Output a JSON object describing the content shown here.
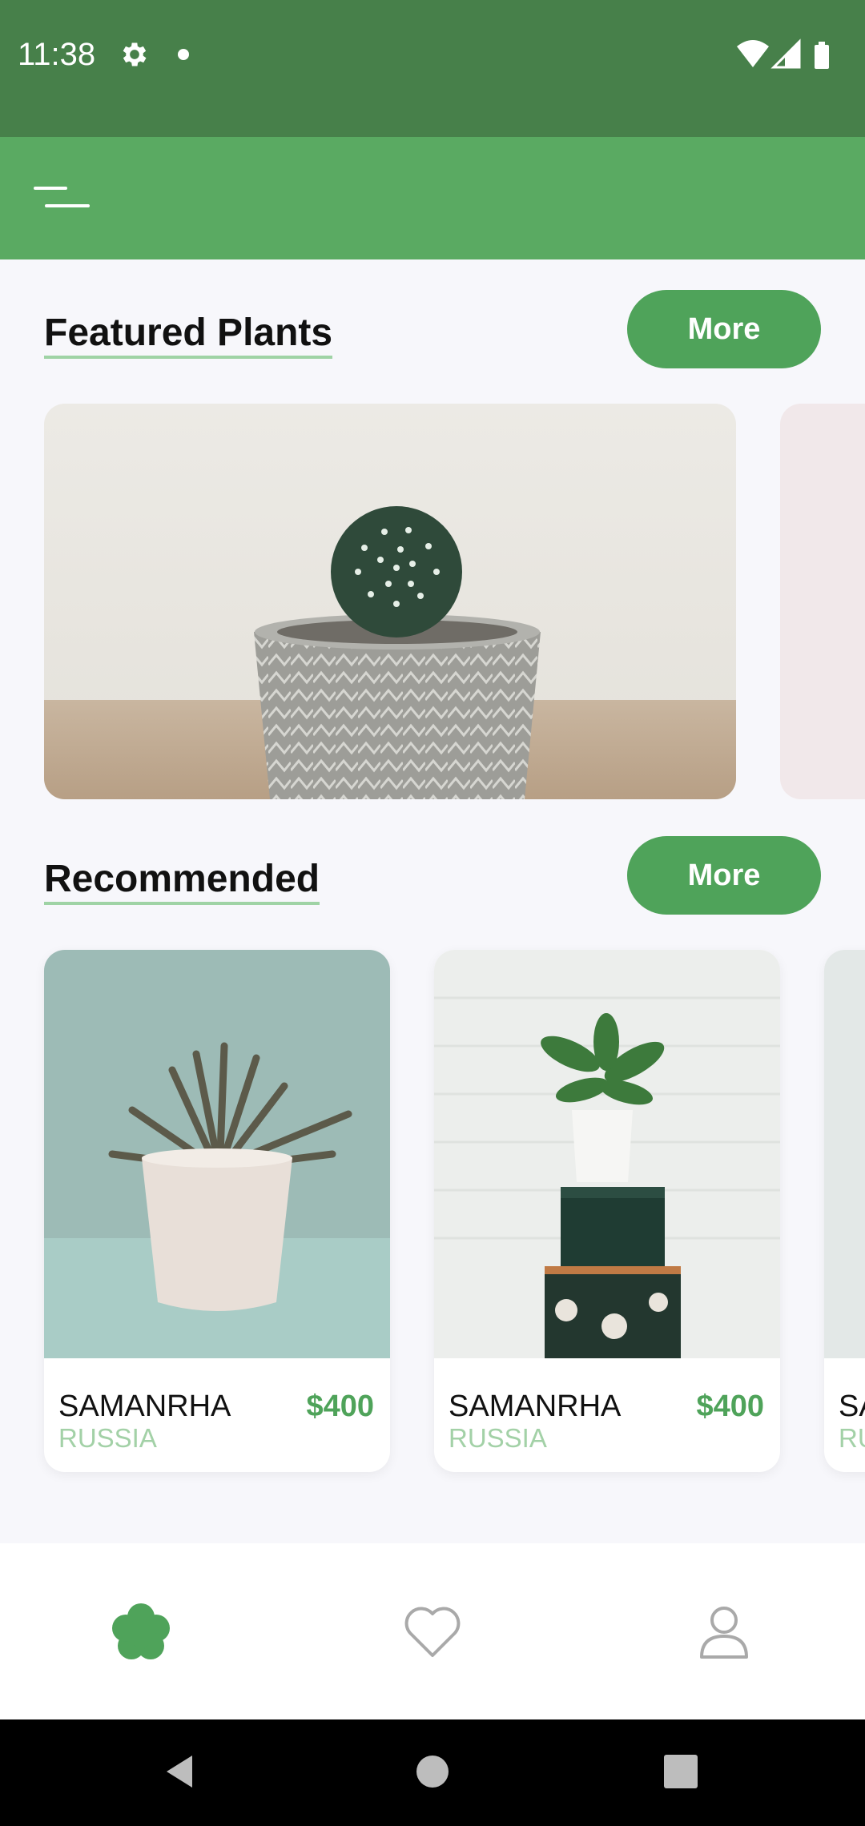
{
  "status_bar": {
    "time": "11:38",
    "icons": [
      "gear-icon",
      "notification-dot",
      "wifi-icon",
      "signal-icon",
      "battery-icon"
    ]
  },
  "app_bar": {
    "menu_icon": "menu-icon"
  },
  "featured": {
    "title": "Featured Plants",
    "more_label": "More"
  },
  "recommended": {
    "title": "Recommended",
    "more_label": "More",
    "items": [
      {
        "name": "SAMANRHA",
        "country": "RUSSIA",
        "price": "$400"
      },
      {
        "name": "SAMANRHA",
        "country": "RUSSIA",
        "price": "$400"
      },
      {
        "name": "SA",
        "country": "RU",
        "price": ""
      }
    ]
  },
  "bottom_nav": {
    "items": [
      "flower-icon",
      "heart-icon",
      "user-icon"
    ],
    "active_color": "#4fa35a"
  },
  "colors": {
    "status_bar": "#47804a",
    "app_bar": "#5aaa62",
    "accent": "#4fa35a",
    "country_text": "#a3d1a7"
  }
}
